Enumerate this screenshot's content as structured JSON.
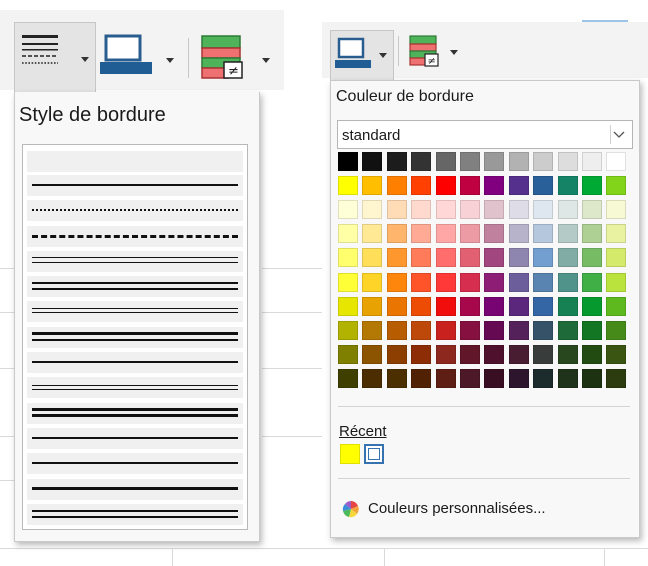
{
  "border_style_menu": {
    "title": "Style de bordure",
    "line_styles": [
      {
        "name": "none",
        "kind": "none"
      },
      {
        "name": "solid-thin",
        "kind": "solid"
      },
      {
        "name": "dotted",
        "kind": "dotted"
      },
      {
        "name": "dashed",
        "kind": "dashed"
      },
      {
        "name": "double-thin",
        "kind": "double"
      },
      {
        "name": "double-medium",
        "kind": "double"
      },
      {
        "name": "double-thin-2",
        "kind": "double"
      },
      {
        "name": "thick-thin",
        "kind": "double"
      },
      {
        "name": "solid-medium",
        "kind": "solid"
      },
      {
        "name": "double-close",
        "kind": "double"
      },
      {
        "name": "thick-double",
        "kind": "double"
      },
      {
        "name": "solid-2",
        "kind": "solid"
      },
      {
        "name": "solid-3",
        "kind": "solid"
      },
      {
        "name": "solid-thick",
        "kind": "solid"
      },
      {
        "name": "double-thick",
        "kind": "double"
      }
    ]
  },
  "border_color_menu": {
    "title": "Couleur de bordure",
    "palette_select": {
      "value": "standard"
    },
    "palette": [
      [
        "#000000",
        "#111111",
        "#1c1c1c",
        "#333333",
        "#666666",
        "#808080",
        "#999999",
        "#b2b2b2",
        "#cccccc",
        "#dddddd",
        "#eeeeee",
        "#ffffff"
      ],
      [
        "#ffff00",
        "#ffbf00",
        "#ff8000",
        "#ff4000",
        "#ff0000",
        "#bf0041",
        "#800080",
        "#55308d",
        "#2a6099",
        "#158466",
        "#00a933",
        "#81d41a"
      ],
      [
        "#ffffd7",
        "#fff5ce",
        "#ffdbb6",
        "#ffd8ce",
        "#ffd7d7",
        "#f7d1d5",
        "#e0c2cd",
        "#dedce6",
        "#dee6ef",
        "#dee7e5",
        "#dde8cb",
        "#f6f9d4"
      ],
      [
        "#ffffa6",
        "#ffe994",
        "#ffb66c",
        "#ffaa95",
        "#ffa6a6",
        "#ec9ba4",
        "#bf819e",
        "#b7b3ca",
        "#b4c7dc",
        "#b3cac7",
        "#afd095",
        "#e8f2a1"
      ],
      [
        "#ffff6d",
        "#ffde59",
        "#ff972f",
        "#ff7b59",
        "#ff6d6d",
        "#e16173",
        "#a1467e",
        "#8e86ae",
        "#729fcf",
        "#81aca6",
        "#77bc65",
        "#d4ea6b"
      ],
      [
        "#ffff38",
        "#ffd428",
        "#ff860d",
        "#ff5429",
        "#ff3838",
        "#d62e4e",
        "#8d1d75",
        "#6b5e9b",
        "#5983b0",
        "#50938a",
        "#3faf46",
        "#bbe33d"
      ],
      [
        "#e6e600",
        "#e8a202",
        "#ea7500",
        "#ed4c05",
        "#f10d0c",
        "#a7074b",
        "#780373",
        "#5b277d",
        "#3465a4",
        "#168253",
        "#069a2e",
        "#5eb91e"
      ],
      [
        "#b2b200",
        "#b47804",
        "#b85c00",
        "#be480a",
        "#c9211e",
        "#861141",
        "#650953",
        "#55215b",
        "#355269",
        "#1e6a39",
        "#127622",
        "#468a1a"
      ],
      [
        "#7f7f00",
        "#8c5301",
        "#8c3f00",
        "#8c2d05",
        "#8d281e",
        "#611729",
        "#4e102d",
        "#481d32",
        "#383d3c",
        "#28471f",
        "#224b12",
        "#395511"
      ],
      [
        "#3f3f00",
        "#4c2d01",
        "#4c2f00",
        "#502103",
        "#5e1e14",
        "#4d1828",
        "#3a0e22",
        "#2d162d",
        "#1c2b2c",
        "#1e3319",
        "#1c3211",
        "#2c3c0f"
      ]
    ],
    "recent_label": "Récent",
    "recent_colors": [
      "#ffff00",
      "#ffffff"
    ],
    "custom_colors_label": "Couleurs personnalisées..."
  }
}
